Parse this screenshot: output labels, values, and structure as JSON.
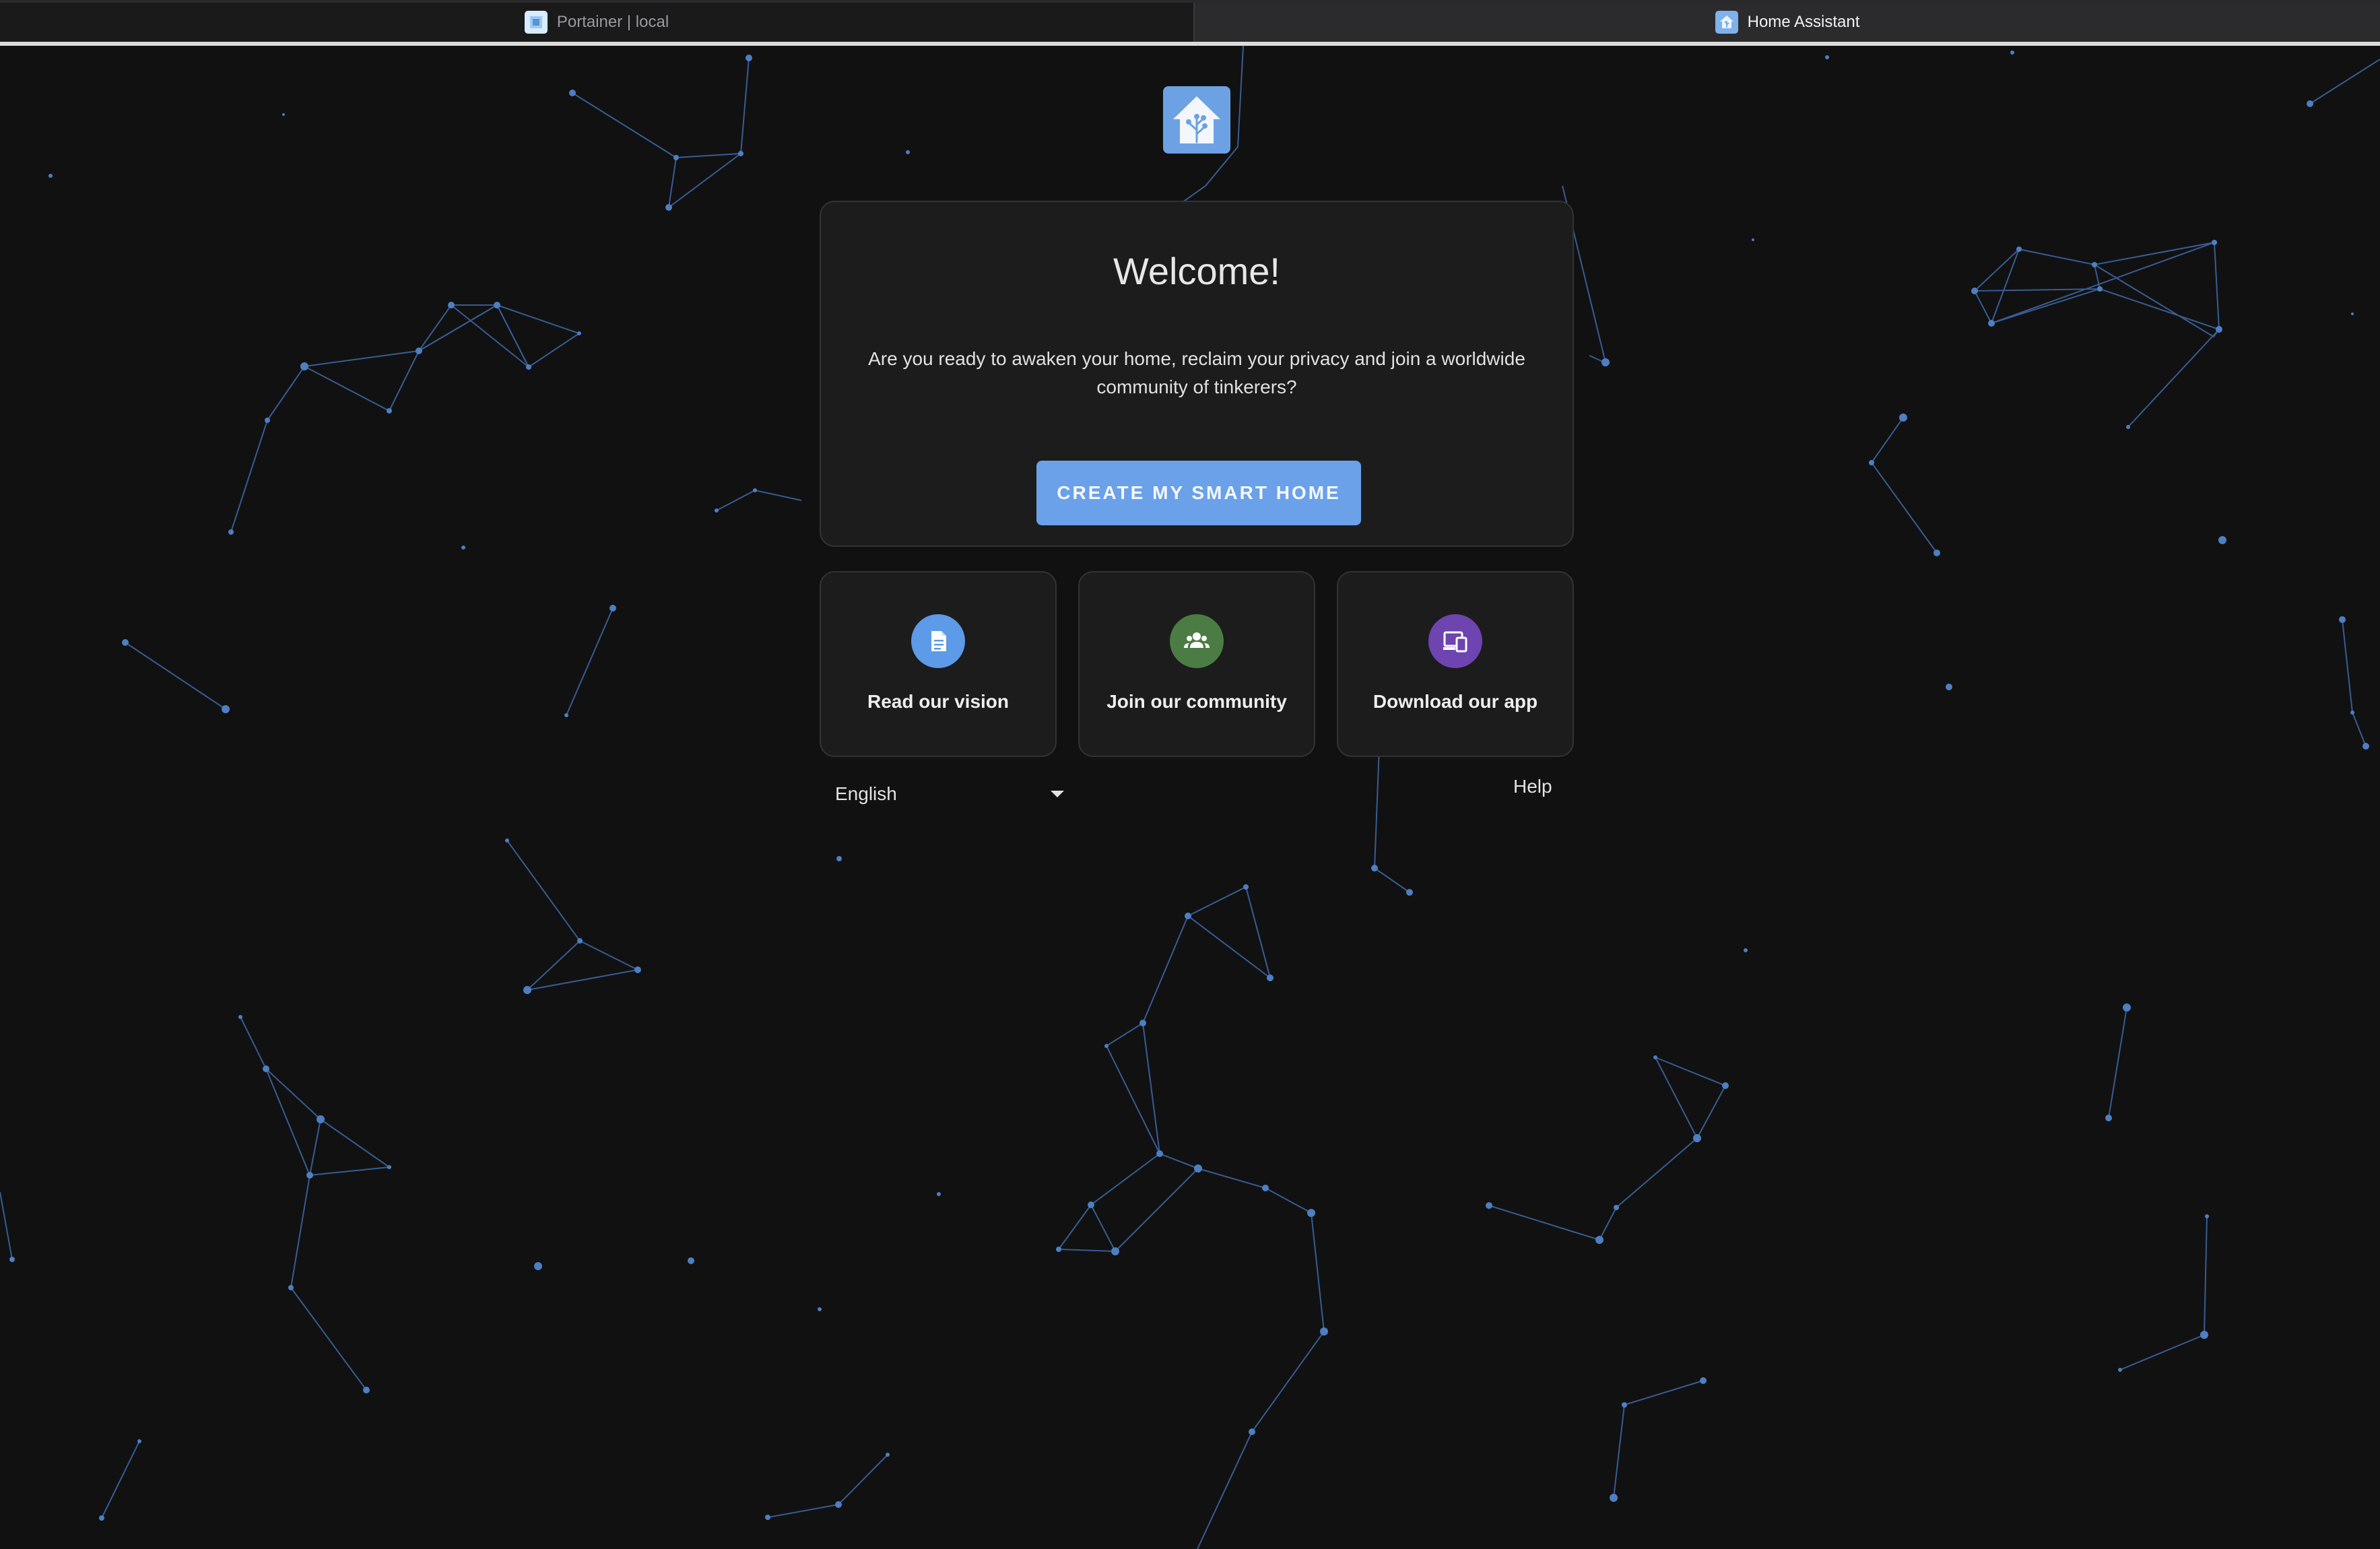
{
  "browser": {
    "tabs": [
      {
        "title": "Portainer | local",
        "active": false,
        "icon": "portainer-favicon"
      },
      {
        "title": "Home Assistant",
        "active": true,
        "icon": "home-assistant-favicon"
      }
    ]
  },
  "onboarding": {
    "logo_icon": "home-assistant-logo-icon",
    "title": "Welcome!",
    "description": "Are you ready to awaken your home, reclaim your privacy and join a worldwide community of tinkerers?",
    "primary_button": "CREATE MY SMART HOME",
    "links": [
      {
        "label": "Read our vision",
        "icon": "document-icon",
        "color": "#5d9ae7"
      },
      {
        "label": "Join our community",
        "icon": "people-icon",
        "color": "#4b7c43"
      },
      {
        "label": "Download our app",
        "icon": "devices-icon",
        "color": "#6d44b0"
      }
    ],
    "language": "English",
    "help": "Help"
  },
  "colors": {
    "background": "#111112",
    "accent": "#6aa1e9",
    "constellation": "#4a78b8"
  }
}
